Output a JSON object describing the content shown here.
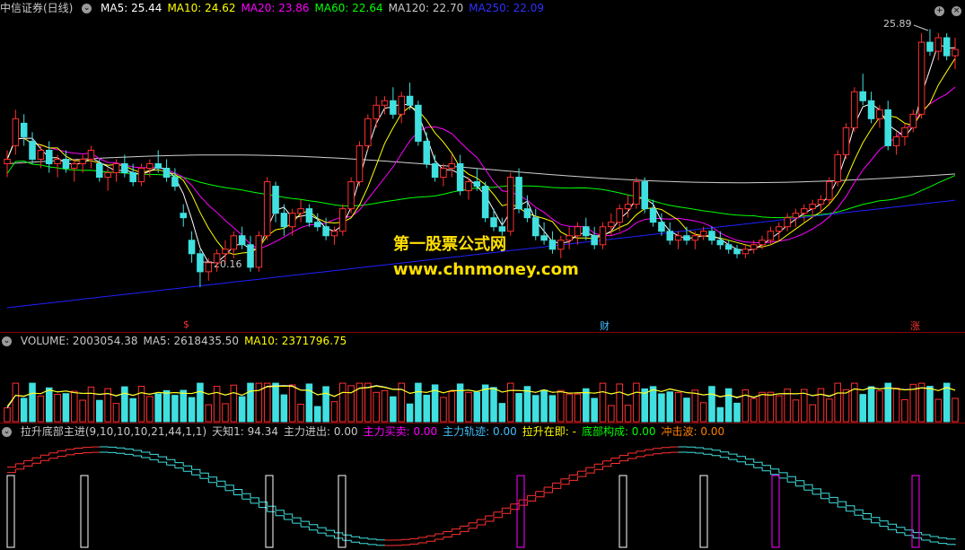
{
  "main": {
    "title": "中信证券(日线)",
    "ma_labels": [
      {
        "text": "MA5: 25.44",
        "color": "#ffffff"
      },
      {
        "text": "MA10: 24.62",
        "color": "#ffff00"
      },
      {
        "text": "MA20: 23.86",
        "color": "#ff00ff"
      },
      {
        "text": "MA60: 22.64",
        "color": "#00ff00"
      },
      {
        "text": "MA120: 22.70",
        "color": "#c8c8c8"
      },
      {
        "text": "MA250: 22.09",
        "color": "#3030ff"
      }
    ],
    "high_label": "25.89",
    "low_label": "20.16",
    "markers": [
      {
        "text": "$",
        "color": "#ff3030"
      },
      {
        "text": "财",
        "color": "#40c0ff"
      },
      {
        "text": "涨",
        "color": "#ff3030"
      }
    ]
  },
  "watermark": {
    "line1": "第一股票公式网",
    "line2": "www.chnmoney.com"
  },
  "volume": {
    "labels": [
      {
        "text": "VOLUME: 2003054.38",
        "color": "#c8c8c8"
      },
      {
        "text": "MA5: 2618435.50",
        "color": "#c8c8c8"
      },
      {
        "text": "MA10: 2371796.75",
        "color": "#ffff00"
      }
    ]
  },
  "indicator": {
    "labels": [
      {
        "text": "拉升底部主进(9,10,10,10,21,44,1,1)",
        "color": "#c8c8c8"
      },
      {
        "text": "天知1: 94.34",
        "color": "#c8c8c8"
      },
      {
        "text": "主力进出: 0.00",
        "color": "#c8c8c8"
      },
      {
        "text": "主力买卖: 0.00",
        "color": "#ff00ff"
      },
      {
        "text": "主力轨迹: 0.00",
        "color": "#40c0ff"
      },
      {
        "text": "拉升在即: -",
        "color": "#ffff00"
      },
      {
        "text": "底部构成: 0.00",
        "color": "#00ff00"
      },
      {
        "text": "冲击波: 0.00",
        "color": "#ff8000"
      }
    ]
  },
  "chart_data": {
    "type": "candlestick",
    "y_range": [
      19.6,
      26.1
    ],
    "candles": [
      [
        22.9,
        23.2,
        22.6,
        23.0
      ],
      [
        23.3,
        24.1,
        23.1,
        23.9
      ],
      [
        23.8,
        24.0,
        23.3,
        23.5
      ],
      [
        23.4,
        23.6,
        22.9,
        23.0
      ],
      [
        23.0,
        23.3,
        22.8,
        23.2
      ],
      [
        23.2,
        23.4,
        22.7,
        22.9
      ],
      [
        22.9,
        23.1,
        22.6,
        23.0
      ],
      [
        23.0,
        23.2,
        22.7,
        22.8
      ],
      [
        22.8,
        23.0,
        22.5,
        22.9
      ],
      [
        22.9,
        23.1,
        22.7,
        23.0
      ],
      [
        23.0,
        23.3,
        22.8,
        23.2
      ],
      [
        22.9,
        23.0,
        22.5,
        22.6
      ],
      [
        22.6,
        22.8,
        22.3,
        22.7
      ],
      [
        22.7,
        23.0,
        22.5,
        22.9
      ],
      [
        22.9,
        23.1,
        22.6,
        22.7
      ],
      [
        22.7,
        22.9,
        22.4,
        22.5
      ],
      [
        22.5,
        22.9,
        22.4,
        22.8
      ],
      [
        22.8,
        23.0,
        22.6,
        22.9
      ],
      [
        22.9,
        23.2,
        22.7,
        22.8
      ],
      [
        22.8,
        23.0,
        22.5,
        22.6
      ],
      [
        22.6,
        22.8,
        22.3,
        22.4
      ],
      [
        21.8,
        22.0,
        21.5,
        21.7
      ],
      [
        21.2,
        21.4,
        20.7,
        20.9
      ],
      [
        20.9,
        21.0,
        20.16,
        20.5
      ],
      [
        20.5,
        20.8,
        20.3,
        20.7
      ],
      [
        20.7,
        21.0,
        20.5,
        20.9
      ],
      [
        20.9,
        21.2,
        20.7,
        21.0
      ],
      [
        21.0,
        21.4,
        20.8,
        21.3
      ],
      [
        21.3,
        21.5,
        21.0,
        21.1
      ],
      [
        21.1,
        21.3,
        20.5,
        20.6
      ],
      [
        20.6,
        21.4,
        20.5,
        21.3
      ],
      [
        21.3,
        22.6,
        21.2,
        22.5
      ],
      [
        22.4,
        22.5,
        21.6,
        21.8
      ],
      [
        21.8,
        22.0,
        21.3,
        21.5
      ],
      [
        21.5,
        21.9,
        21.3,
        21.8
      ],
      [
        21.8,
        22.1,
        21.6,
        21.9
      ],
      [
        21.9,
        22.0,
        21.5,
        21.6
      ],
      [
        21.6,
        21.8,
        21.4,
        21.5
      ],
      [
        21.5,
        21.7,
        21.2,
        21.3
      ],
      [
        21.3,
        21.5,
        21.1,
        21.4
      ],
      [
        21.4,
        22.0,
        21.3,
        21.9
      ],
      [
        21.9,
        22.6,
        21.8,
        22.5
      ],
      [
        22.5,
        23.4,
        22.4,
        23.3
      ],
      [
        23.3,
        24.0,
        23.2,
        23.9
      ],
      [
        23.9,
        24.4,
        23.7,
        24.2
      ],
      [
        24.2,
        24.4,
        24.0,
        24.3
      ],
      [
        24.3,
        24.6,
        23.9,
        24.0
      ],
      [
        24.0,
        24.5,
        23.8,
        24.4
      ],
      [
        24.4,
        24.7,
        24.1,
        24.2
      ],
      [
        24.2,
        24.3,
        23.3,
        23.4
      ],
      [
        23.4,
        23.6,
        22.8,
        22.9
      ],
      [
        22.9,
        23.1,
        22.5,
        22.6
      ],
      [
        22.6,
        22.9,
        22.4,
        22.8
      ],
      [
        22.8,
        23.1,
        22.6,
        22.9
      ],
      [
        22.9,
        23.1,
        22.2,
        22.3
      ],
      [
        22.3,
        22.6,
        22.1,
        22.5
      ],
      [
        22.5,
        22.8,
        22.3,
        22.4
      ],
      [
        22.4,
        22.5,
        21.6,
        21.7
      ],
      [
        21.7,
        21.9,
        21.4,
        21.5
      ],
      [
        21.5,
        21.7,
        21.3,
        21.4
      ],
      [
        21.4,
        22.7,
        21.3,
        22.6
      ],
      [
        22.6,
        22.8,
        21.8,
        21.9
      ],
      [
        21.9,
        22.2,
        21.6,
        21.7
      ],
      [
        21.7,
        21.9,
        21.2,
        21.3
      ],
      [
        21.3,
        21.6,
        21.1,
        21.2
      ],
      [
        21.2,
        21.4,
        20.9,
        21.0
      ],
      [
        21.0,
        21.3,
        20.8,
        21.2
      ],
      [
        21.2,
        21.5,
        21.0,
        21.3
      ],
      [
        21.3,
        21.6,
        21.1,
        21.5
      ],
      [
        21.5,
        21.7,
        21.2,
        21.3
      ],
      [
        21.3,
        21.5,
        21.0,
        21.1
      ],
      [
        21.1,
        21.6,
        21.0,
        21.5
      ],
      [
        21.5,
        21.8,
        21.3,
        21.6
      ],
      [
        21.6,
        22.0,
        21.4,
        21.9
      ],
      [
        21.9,
        22.2,
        21.7,
        22.0
      ],
      [
        22.0,
        22.6,
        21.9,
        22.5
      ],
      [
        22.5,
        22.6,
        21.8,
        21.9
      ],
      [
        21.9,
        22.1,
        21.5,
        21.6
      ],
      [
        21.6,
        21.8,
        21.3,
        21.4
      ],
      [
        21.4,
        21.6,
        21.1,
        21.2
      ],
      [
        21.2,
        21.4,
        21.0,
        21.3
      ],
      [
        21.3,
        21.5,
        21.1,
        21.2
      ],
      [
        21.2,
        21.4,
        21.0,
        21.3
      ],
      [
        21.3,
        21.5,
        21.2,
        21.4
      ],
      [
        21.4,
        21.5,
        21.1,
        21.2
      ],
      [
        21.2,
        21.4,
        21.0,
        21.1
      ],
      [
        21.1,
        21.2,
        20.9,
        21.0
      ],
      [
        21.0,
        21.1,
        20.8,
        20.9
      ],
      [
        20.9,
        21.1,
        20.8,
        21.0
      ],
      [
        21.0,
        21.2,
        20.9,
        21.1
      ],
      [
        21.1,
        21.3,
        21.0,
        21.2
      ],
      [
        21.2,
        21.5,
        21.1,
        21.4
      ],
      [
        21.4,
        21.6,
        21.2,
        21.5
      ],
      [
        21.5,
        21.8,
        21.4,
        21.7
      ],
      [
        21.7,
        21.9,
        21.5,
        21.8
      ],
      [
        21.8,
        22.0,
        21.6,
        21.9
      ],
      [
        21.9,
        22.1,
        21.7,
        22.0
      ],
      [
        22.0,
        22.2,
        21.8,
        22.1
      ],
      [
        22.1,
        22.6,
        22.0,
        22.5
      ],
      [
        22.5,
        23.2,
        22.4,
        23.1
      ],
      [
        23.1,
        23.8,
        23.0,
        23.7
      ],
      [
        23.7,
        24.6,
        23.6,
        24.5
      ],
      [
        24.5,
        24.9,
        24.2,
        24.3
      ],
      [
        24.3,
        24.5,
        23.8,
        23.9
      ],
      [
        23.9,
        24.2,
        23.7,
        24.1
      ],
      [
        24.1,
        24.3,
        23.2,
        23.3
      ],
      [
        23.3,
        23.6,
        23.1,
        23.5
      ],
      [
        23.5,
        23.8,
        23.3,
        23.7
      ],
      [
        23.7,
        24.1,
        23.6,
        24.0
      ],
      [
        24.0,
        25.8,
        23.9,
        25.6
      ],
      [
        25.6,
        25.89,
        25.3,
        25.4
      ],
      [
        25.4,
        25.8,
        25.2,
        25.7
      ],
      [
        25.7,
        25.8,
        25.2,
        25.3
      ],
      [
        25.3,
        25.7,
        25.0,
        25.44
      ]
    ],
    "ma250_start": 19.7,
    "ma250_end": 22.09
  }
}
